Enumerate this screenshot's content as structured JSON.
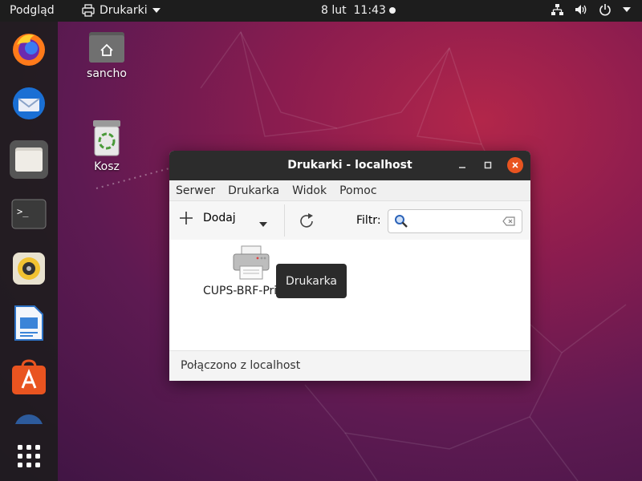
{
  "topbar": {
    "activities": "Podgląd",
    "app_name": "Drukarki",
    "clock_date": "8 lut",
    "clock_time": "11:43"
  },
  "dock": {
    "items": [
      {
        "name": "firefox-icon"
      },
      {
        "name": "thunderbird-icon"
      },
      {
        "name": "files-icon"
      },
      {
        "name": "terminal-icon"
      },
      {
        "name": "rhythmbox-icon"
      },
      {
        "name": "writer-icon"
      },
      {
        "name": "software-icon"
      },
      {
        "name": "help-icon"
      }
    ]
  },
  "desktop": {
    "home_label": "sancho",
    "trash_label": "Kosz"
  },
  "window": {
    "title": "Drukarki - localhost",
    "menu": [
      "Serwer",
      "Drukarka",
      "Widok",
      "Pomoc"
    ],
    "toolbar": {
      "add_label": "Dodaj",
      "filter_label": "Filtr:",
      "filter_value": ""
    },
    "printers": [
      {
        "name": "CUPS-BRF-Printer"
      }
    ],
    "tooltip": "Drukarka",
    "status": "Połączono z localhost"
  },
  "colors": {
    "close_button": "#e95420",
    "dock_bg": "#1c1c1c",
    "titlebar_bg": "#2c2c2c"
  }
}
